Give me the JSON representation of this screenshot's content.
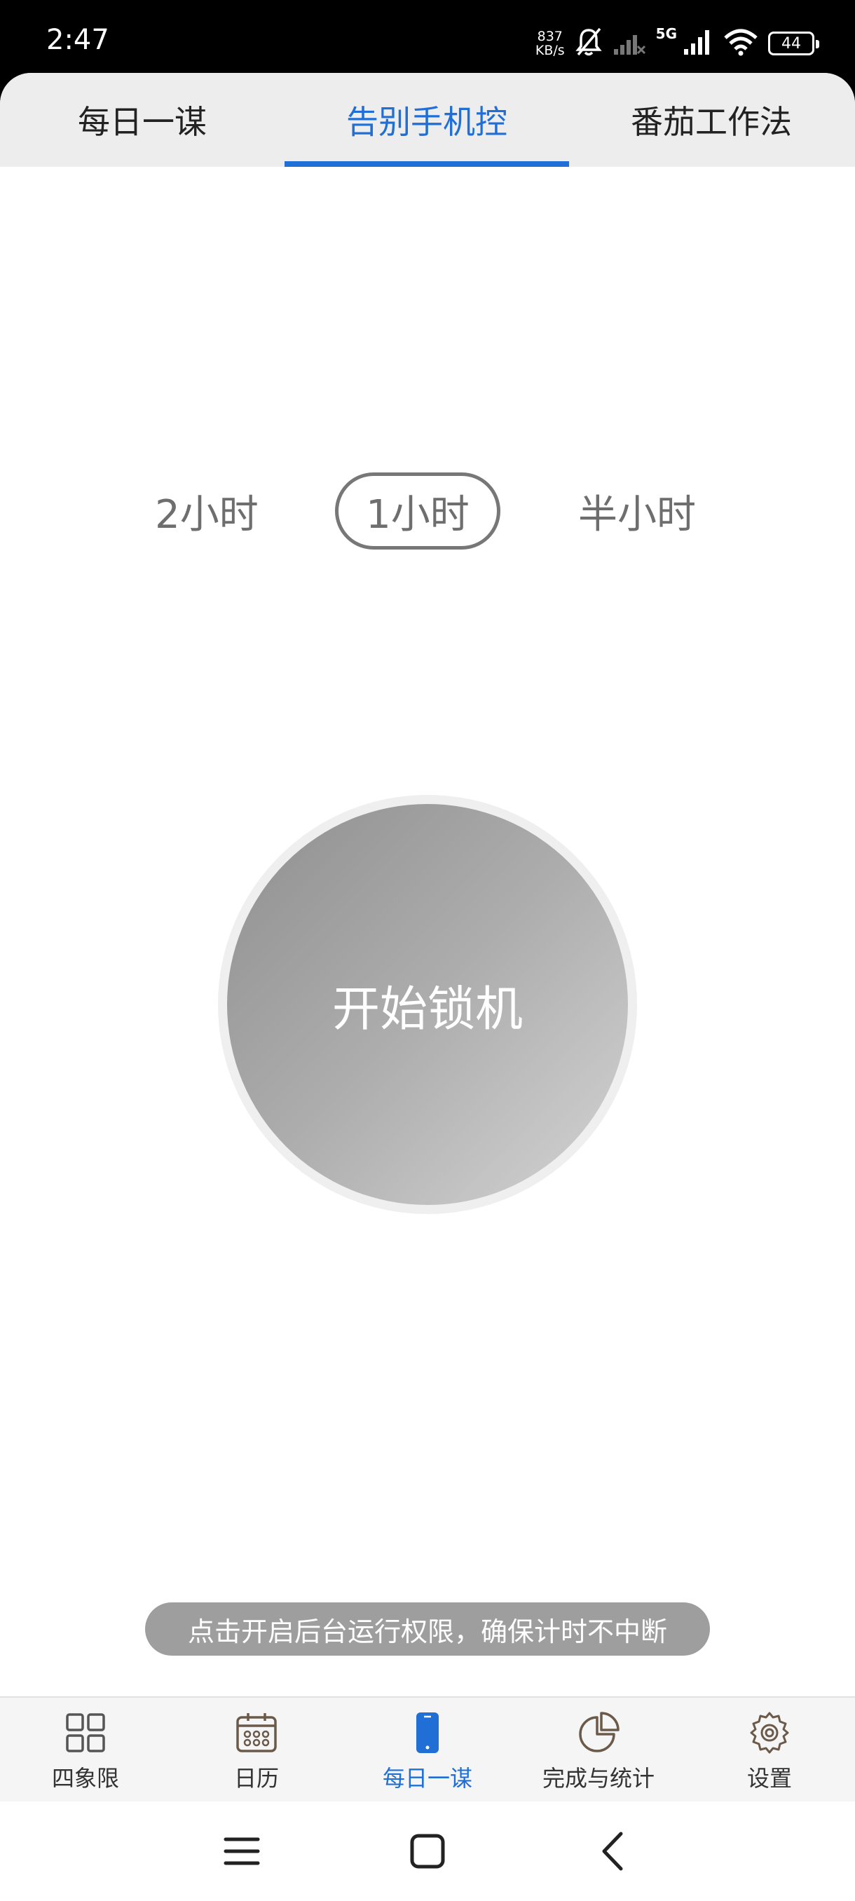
{
  "status_bar": {
    "time": "2:47",
    "net_speed_value": "837",
    "net_speed_unit": "KB/s",
    "network_type": "5G",
    "battery": "44"
  },
  "top_tabs": [
    {
      "label": "每日一谋"
    },
    {
      "label": "告别手机控"
    },
    {
      "label": "番茄工作法"
    }
  ],
  "durations": [
    {
      "label": "2小时"
    },
    {
      "label": "1小时"
    },
    {
      "label": "半小时"
    }
  ],
  "lock_button": {
    "label": "开始锁机"
  },
  "permission_hint": "点击开启后台运行权限，确保计时不中断",
  "bottom_nav": [
    {
      "label": "四象限",
      "icon": "grid-icon"
    },
    {
      "label": "日历",
      "icon": "calendar-icon"
    },
    {
      "label": "每日一谋",
      "icon": "phone-icon"
    },
    {
      "label": "完成与统计",
      "icon": "pie-chart-icon"
    },
    {
      "label": "设置",
      "icon": "gear-icon"
    }
  ],
  "colors": {
    "accent": "#1f6fd6",
    "tab_bar_bg": "#ededed",
    "button_gradient_start": "#8f8f8f",
    "button_gradient_end": "#d4d4d4",
    "toast_bg": "#9e9e9e"
  }
}
